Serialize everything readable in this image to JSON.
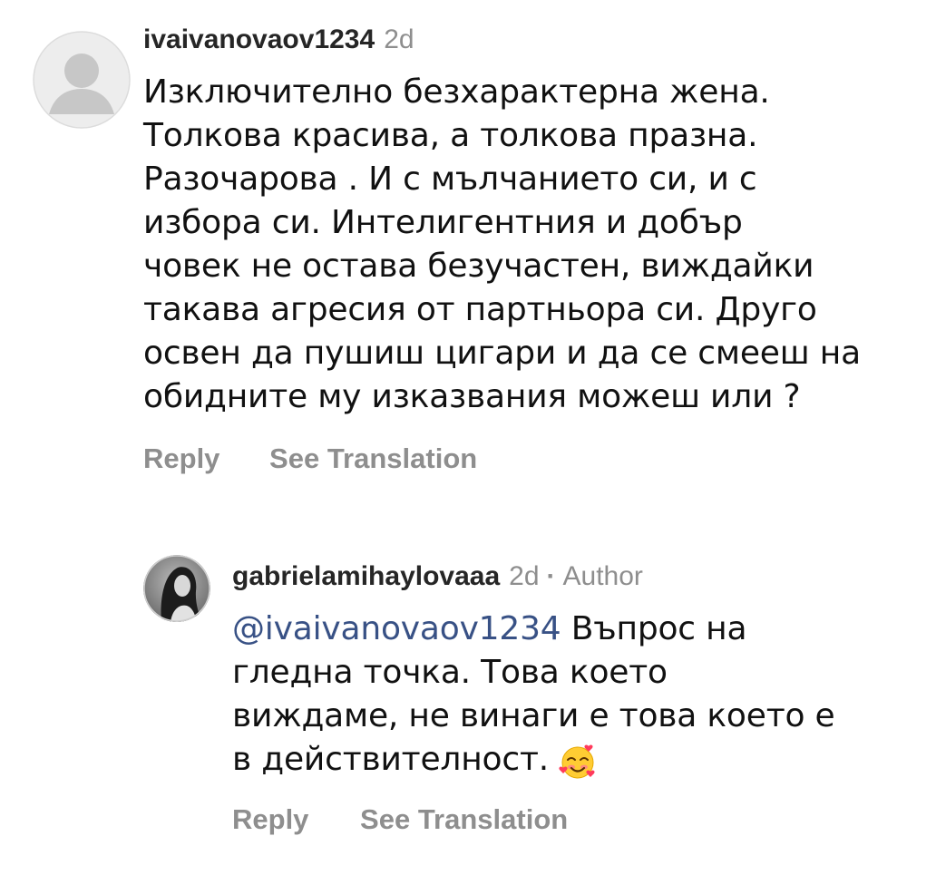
{
  "comment": {
    "username": "ivaivanovaov1234",
    "time": "2d",
    "lines": [
      "Изключително безхарактерна жена.",
      "Толкова красива, а толкова празна.",
      "Разочарова . И с мълчанието си, и с",
      "избора си. Интелигентния и добър",
      "човек не остава безучастен, виждайки",
      "такава агресия от партньора си. Друго",
      "освен да пушиш цигари и да се смееш на",
      "обидните му изказвания можеш или ?"
    ],
    "reply_label": "Reply",
    "translate_label": "See Translation",
    "avatar_icon": "default-user-avatar-icon"
  },
  "reply": {
    "username": "gabrielamihaylovaaa",
    "time": "2d",
    "separator": "·",
    "badge": "Author",
    "mention": "@ivaivanovaov1234",
    "lines": [
      " Въпрос на",
      "гледна точка. Това което",
      "виждаме, не винаги е това което е",
      "в действителност."
    ],
    "emoji": "smiling-face-with-hearts-emoji",
    "reply_label": "Reply",
    "translate_label": "See Translation"
  },
  "colors": {
    "username": "#262626",
    "secondary": "#8e8e8e",
    "mention": "#385185",
    "text": "#111111"
  }
}
